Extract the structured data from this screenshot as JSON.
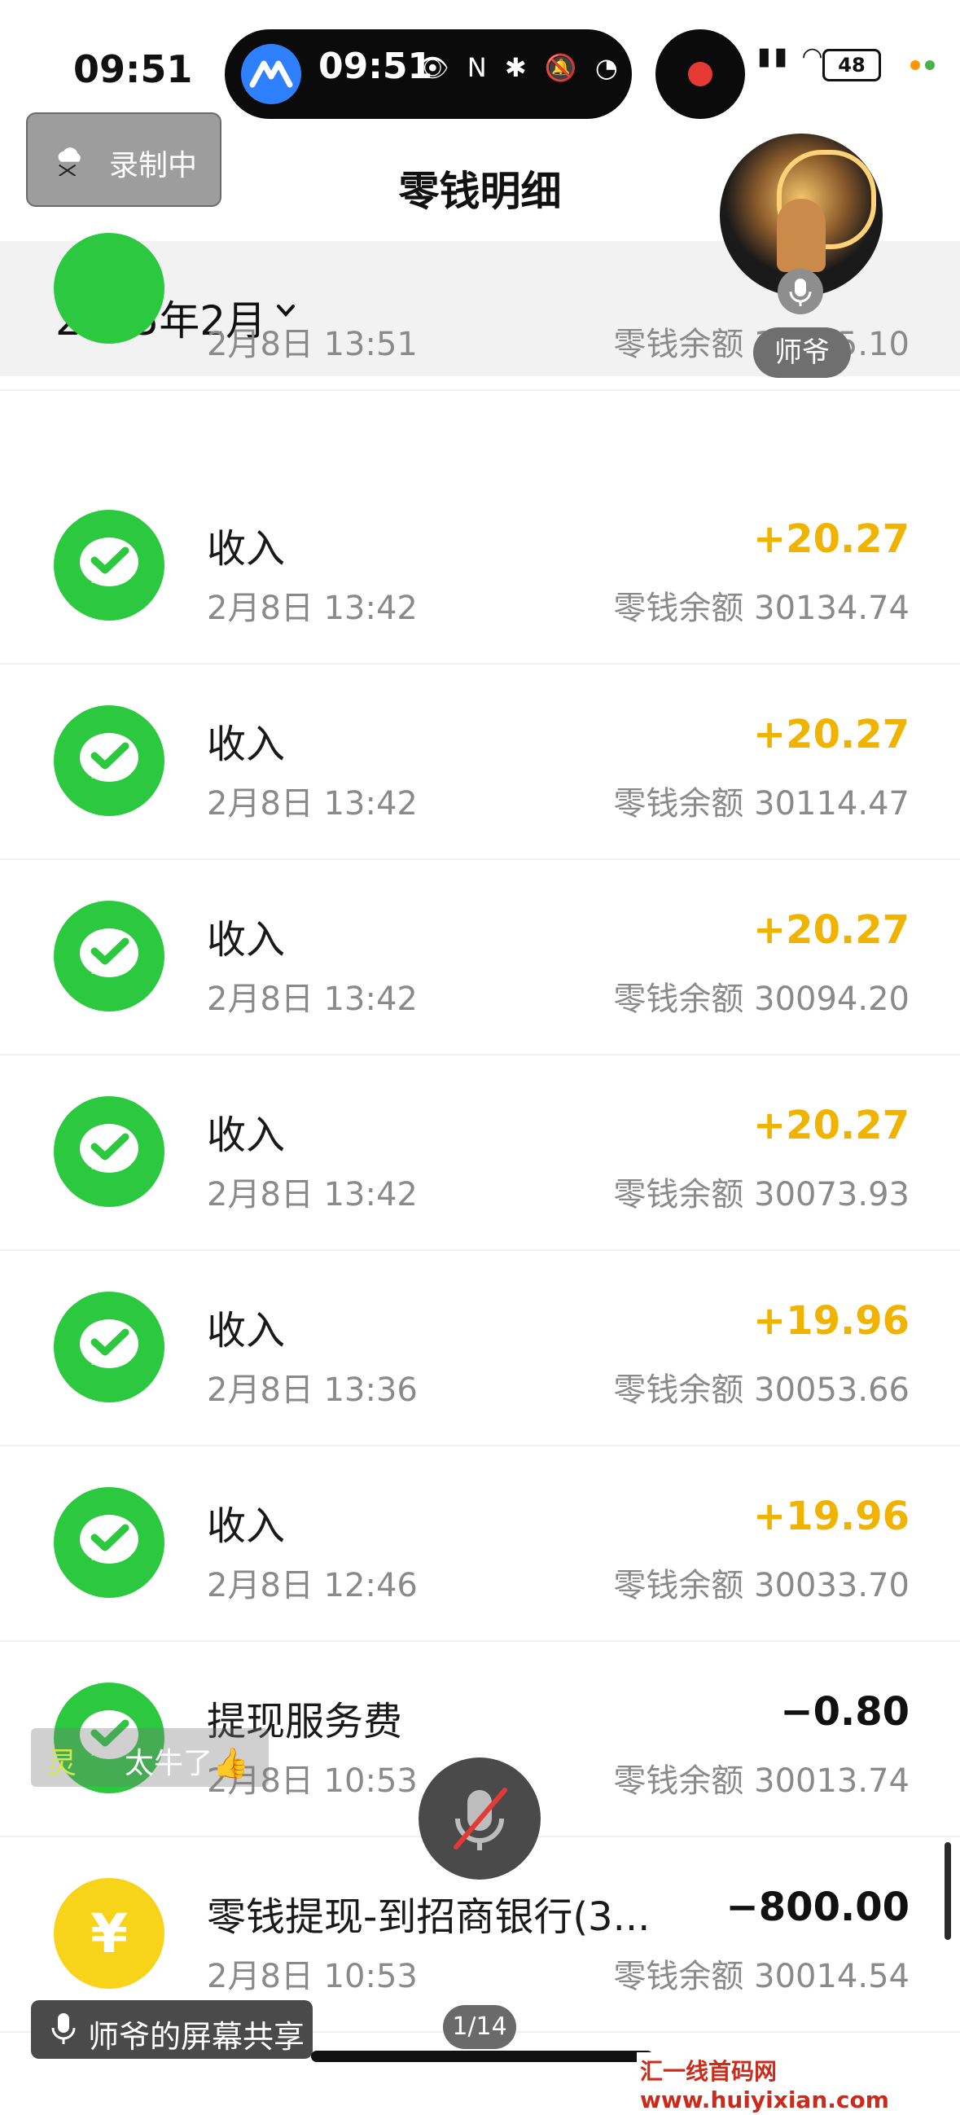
{
  "status_bar": {
    "time": "09:51",
    "island_time": "09:51",
    "battery": "48"
  },
  "recording": {
    "label": "录制中"
  },
  "header": {
    "title": "零钱明细"
  },
  "filter": {
    "month": "2025年2月"
  },
  "presenter": {
    "name": "师爷"
  },
  "list": {
    "partial_row": {
      "date": "2月8日 13:51",
      "balance": "零钱余额 30155.10"
    },
    "rows": [
      {
        "title": "收入",
        "date": "2月8日 13:42",
        "amount": "+20.27",
        "balance": "零钱余额 30134.74",
        "icon": "wechat-pay-icon"
      },
      {
        "title": "收入",
        "date": "2月8日 13:42",
        "amount": "+20.27",
        "balance": "零钱余额 30114.47",
        "icon": "wechat-pay-icon"
      },
      {
        "title": "收入",
        "date": "2月8日 13:42",
        "amount": "+20.27",
        "balance": "零钱余额 30094.20",
        "icon": "wechat-pay-icon"
      },
      {
        "title": "收入",
        "date": "2月8日 13:42",
        "amount": "+20.27",
        "balance": "零钱余额 30073.93",
        "icon": "wechat-pay-icon"
      },
      {
        "title": "收入",
        "date": "2月8日 13:36",
        "amount": "+19.96",
        "balance": "零钱余额 30053.66",
        "icon": "wechat-pay-icon"
      },
      {
        "title": "收入",
        "date": "2月8日 12:46",
        "amount": "+19.96",
        "balance": "零钱余额 30033.70",
        "icon": "wechat-pay-icon"
      },
      {
        "title": "提现服务费",
        "date": "2月8日 10:53",
        "amount": "−0.80",
        "balance": "零钱余额 30013.74",
        "icon": "wechat-pay-icon"
      },
      {
        "title": "零钱提现-到招商银行(3...",
        "date": "2月8日 10:53",
        "amount": "−800.00",
        "balance": "零钱余额 30014.54",
        "icon": "yen-icon"
      }
    ]
  },
  "overlay": {
    "comment_user": "灵",
    "comment_text": "太牛了👍",
    "share_label": "师爷的屏幕共享",
    "page_indicator": "1/14",
    "watermark": "汇一线首码网 www.huiyixian.com"
  },
  "colors": {
    "income": "#f0b400",
    "wechat_green": "#2bc840",
    "yen_yellow": "#f7d319"
  }
}
